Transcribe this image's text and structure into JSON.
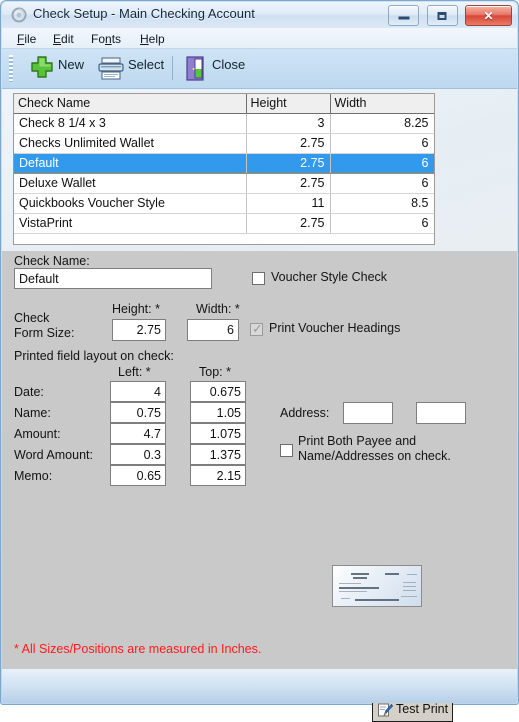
{
  "window": {
    "title": "Check Setup - Main Checking Account",
    "icon": "app-swirl-icon",
    "buttons": {
      "minimize": "minimize",
      "maximize": "maximize",
      "close": "✕"
    }
  },
  "menubar": {
    "items": [
      {
        "label": "File",
        "mnemonic": "F",
        "rest": "ile"
      },
      {
        "label": "Edit",
        "mnemonic": "E",
        "rest": "dit"
      },
      {
        "label": "Fonts",
        "pre": "Fo",
        "mnemonic": "n",
        "rest": "ts"
      },
      {
        "label": "Help",
        "mnemonic": "H",
        "rest": "elp"
      }
    ]
  },
  "toolbar": {
    "new_label": "New",
    "select_label": "Select",
    "close_label": "Close"
  },
  "table": {
    "columns": [
      "Check Name",
      "Height",
      "Width"
    ],
    "rows": [
      {
        "name": "Check 8 1/4 x 3",
        "height": "3",
        "width": "8.25",
        "selected": false
      },
      {
        "name": "Checks Unlimited Wallet",
        "height": "2.75",
        "width": "6",
        "selected": false
      },
      {
        "name": "Default",
        "height": "2.75",
        "width": "6",
        "selected": true
      },
      {
        "name": "Deluxe Wallet",
        "height": "2.75",
        "width": "6",
        "selected": false
      },
      {
        "name": "Quickbooks Voucher Style",
        "height": "11",
        "width": "8.5",
        "selected": false
      },
      {
        "name": "VistaPrint",
        "height": "2.75",
        "width": "6",
        "selected": false
      }
    ]
  },
  "form": {
    "check_name_label": "Check Name:",
    "check_name_value": "Default",
    "voucher_style_label": "Voucher Style Check",
    "voucher_style_checked": false,
    "form_size_label_line1": "Check",
    "form_size_label_line2": "Form Size:",
    "height_label": "Height: *",
    "width_label": "Width: *",
    "form_height": "2.75",
    "form_width": "6",
    "print_voucher_headings_label": "Print Voucher Headings",
    "print_voucher_headings_checked": true,
    "print_voucher_headings_tick": "✓",
    "layout_section_label": "Printed field layout on check:",
    "left_label": "Left: *",
    "top_label": "Top: *",
    "fields": [
      {
        "label": "Date:",
        "left": "4",
        "top": "0.675"
      },
      {
        "label": "Name:",
        "left": "0.75",
        "top": "1.05"
      },
      {
        "label": "Amount:",
        "left": "4.7",
        "top": "1.075"
      },
      {
        "label": "Word Amount:",
        "left": "0.3",
        "top": "1.375"
      },
      {
        "label": "Memo:",
        "left": "0.65",
        "top": "2.15"
      }
    ],
    "address_label": "Address:",
    "address_left": "",
    "address_top": "",
    "print_both_label_line1": "Print Both Payee and",
    "print_both_label_line2": "Name/Addresses on check.",
    "print_both_checked": false
  },
  "preview": {
    "alt": "check-preview-thumbnail"
  },
  "actions": {
    "test_print_label": "Test Print"
  },
  "footer": {
    "note": "* All Sizes/Positions are measured in Inches."
  }
}
